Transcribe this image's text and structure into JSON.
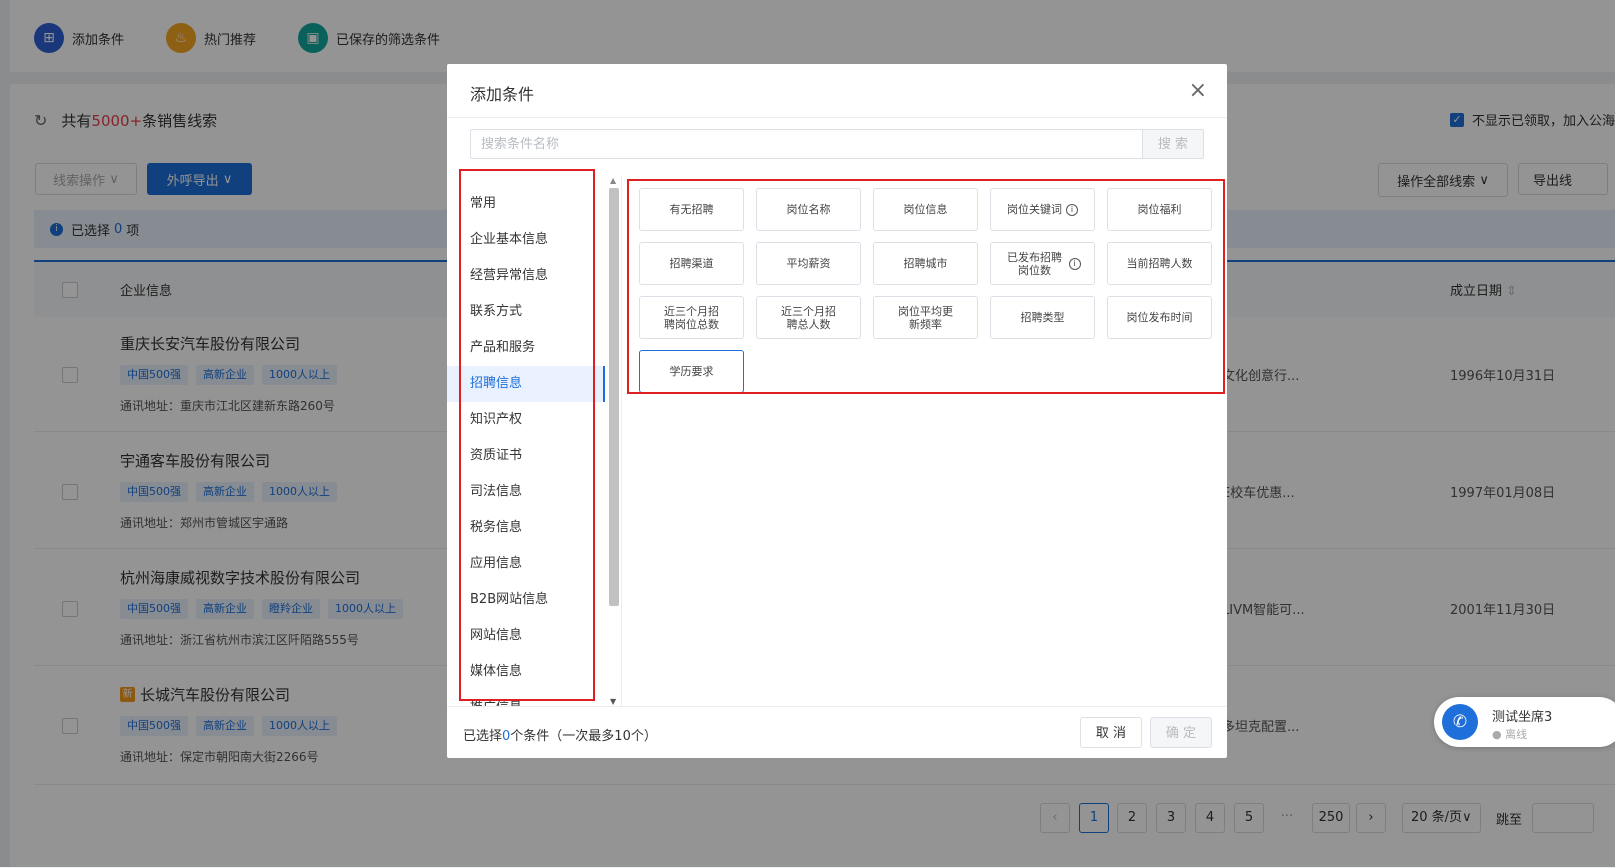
{
  "toolbar": {
    "add_condition": "添加条件",
    "hot_recommend": "热门推荐",
    "saved_filters": "已保存的筛选条件"
  },
  "colors": {
    "accent": "#1e6fd9",
    "add_icon": "#2f5fd6",
    "hot_icon": "#f5a623",
    "saved_icon": "#12a89d",
    "highlight_border": "#e02020"
  },
  "list": {
    "count_prefix": "共有",
    "count_value": "5000+",
    "count_suffix": "条销售线索",
    "hide_claimed": "不显示已领取，加入公海",
    "clue_ops": "线索操作",
    "call_export": "外呼导出",
    "operate_all": "操作全部线索",
    "export": "导出线",
    "selected_prefix": "已选择",
    "selected_count": "0",
    "selected_suffix": "项",
    "col_company": "企业信息",
    "col_date": "成立日期",
    "rows": [
      {
        "name": "重庆长安汽车股份有限公司",
        "tags": [
          "中国500强",
          "高新企业",
          "1000人以上"
        ],
        "address": "通讯地址：重庆市江北区建新东路260号",
        "mid": "文化创意行...",
        "date": "1996年10月31日"
      },
      {
        "name": "宇通客车股份有限公司",
        "tags": [
          "中国500强",
          "高新企业",
          "1000人以上"
        ],
        "address": "通讯地址：郑州市管城区宇通路",
        "mid": "E校车优惠...",
        "date": "1997年01月08日"
      },
      {
        "name": "杭州海康威视数字技术股份有限公司",
        "tags": [
          "中国500强",
          "高新企业",
          "瞪羚企业",
          "1000人以上"
        ],
        "address": "通讯地址：浙江省杭州市滨江区阡陌路555号",
        "mid": "LIVM智能可...",
        "date": "2001年11月30日"
      },
      {
        "name": "长城汽车股份有限公司",
        "badge": "新",
        "tags": [
          "中国500强",
          "高新企业",
          "1000人以上"
        ],
        "address": "通讯地址：保定市朝阳南大街2266号",
        "mid": "多坦克配置...",
        "date": ""
      }
    ]
  },
  "pagination": {
    "pages": [
      "1",
      "2",
      "3",
      "4",
      "5",
      "···",
      "250"
    ],
    "current": "1",
    "per_page": "20 条/页",
    "jump": "跳至"
  },
  "call_widget": {
    "name": "测试坐席3",
    "status": "离线"
  },
  "modal": {
    "title": "添加条件",
    "search_placeholder": "搜索条件名称",
    "search_btn": "搜 索",
    "categories": [
      "常用",
      "企业基本信息",
      "经营异常信息",
      "联系方式",
      "产品和服务",
      "招聘信息",
      "知识产权",
      "资质证书",
      "司法信息",
      "税务信息",
      "应用信息",
      "B2B网站信息",
      "网站信息",
      "媒体信息",
      "推广信息"
    ],
    "active_category": "招聘信息",
    "items": [
      "有无招聘",
      "岗位名称",
      "岗位信息",
      "岗位关键词",
      "岗位福利",
      "招聘渠道",
      "平均薪资",
      "招聘城市",
      "已发布招聘岗位数",
      "当前招聘人数",
      "近三个月招聘岗位总数",
      "近三个月招聘总人数",
      "岗位平均更新频率",
      "招聘类型",
      "岗位发布时间",
      "学历要求"
    ],
    "footer_prefix": "已选择",
    "footer_count": "0",
    "footer_suffix": "个条件（一次最多10个）",
    "cancel": "取 消",
    "confirm": "确 定"
  }
}
